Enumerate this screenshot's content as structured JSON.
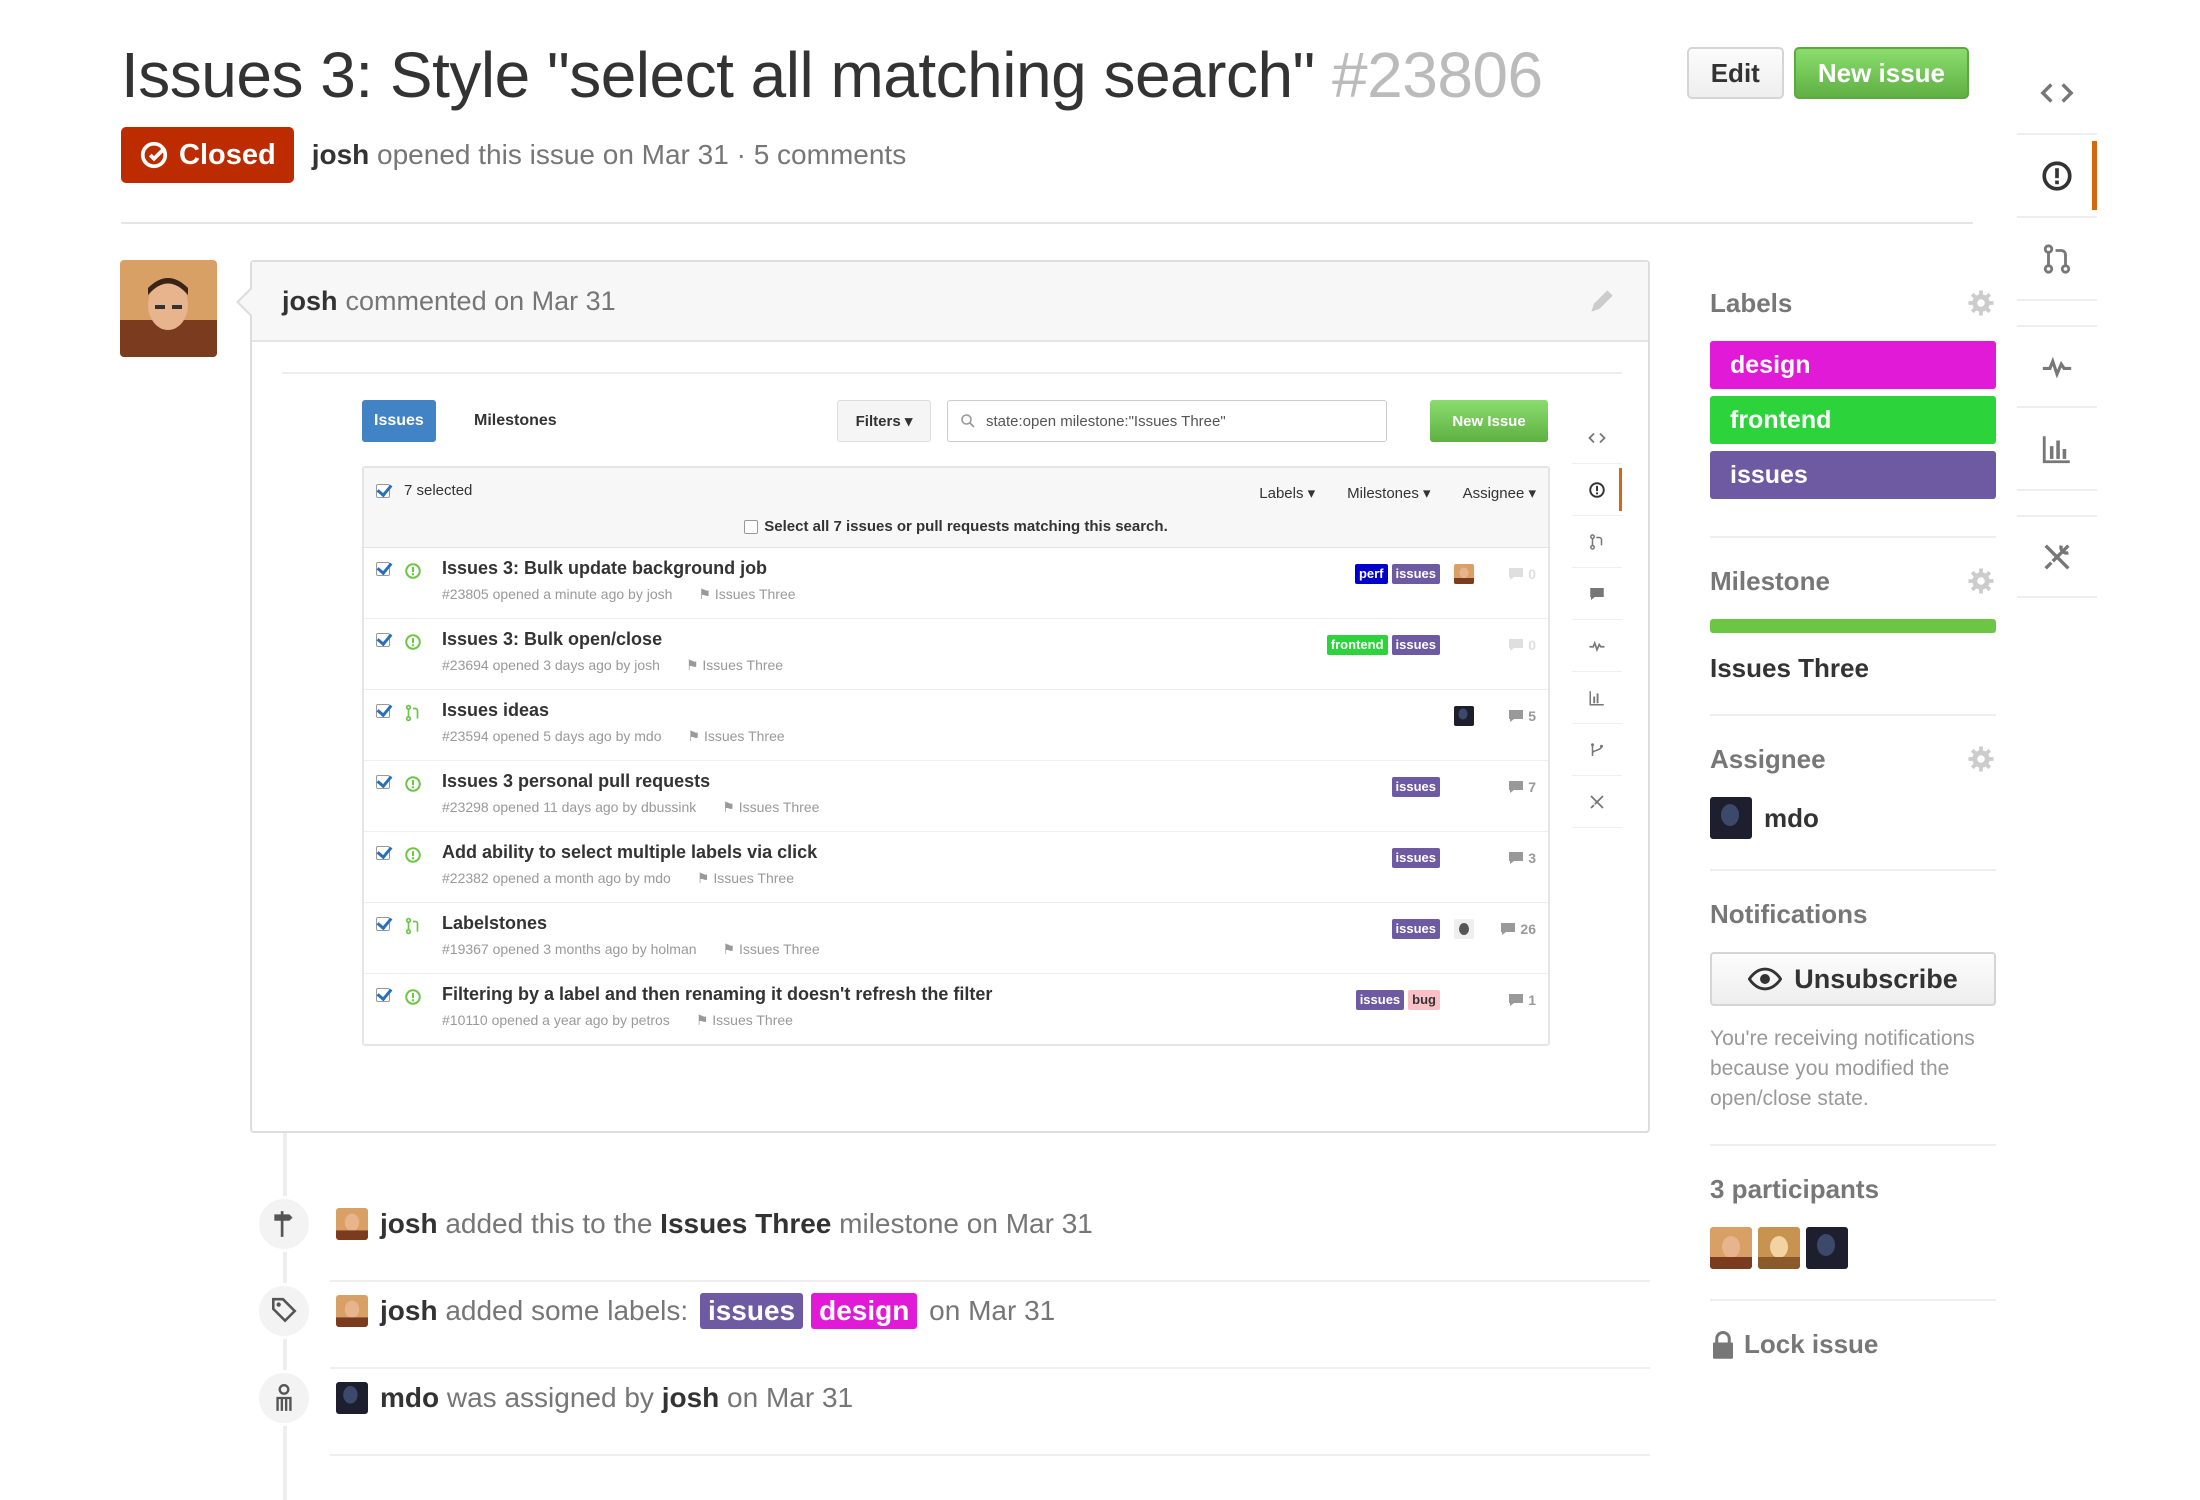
{
  "issue": {
    "title": "Issues 3: Style \"select all matching search\"",
    "number": "#23806",
    "state": "Closed",
    "author": "josh",
    "opened_text": "opened this issue on Mar 31 · 5 comments"
  },
  "header": {
    "edit_label": "Edit",
    "new_issue_label": "New issue"
  },
  "comment": {
    "author": "josh",
    "meta": "commented on Mar 31"
  },
  "screenshot": {
    "tabs": [
      "Issues",
      "Milestones"
    ],
    "filters_label": "Filters",
    "search_value": "state:open milestone:\"Issues Three\"",
    "new_issue_label": "New Issue",
    "selected_text": "7 selected",
    "dropdowns": [
      "Labels",
      "Milestones",
      "Assignee"
    ],
    "select_all_text": "Select all 7 issues or pull requests matching this search.",
    "rows": [
      {
        "kind": "issue",
        "title": "Issues 3: Bulk update background job",
        "sub": "#23805 opened a minute ago by josh",
        "milestone": "Issues Three",
        "labels": [
          {
            "name": "perf",
            "color": "#0000cc"
          },
          {
            "name": "issues",
            "color": "#6e59a3"
          }
        ],
        "avatar": "josh",
        "comments": "0"
      },
      {
        "kind": "issue",
        "title": "Issues 3: Bulk open/close",
        "sub": "#23694 opened 3 days ago by josh",
        "milestone": "Issues Three",
        "labels": [
          {
            "name": "frontend",
            "color": "#2cd33b"
          },
          {
            "name": "issues",
            "color": "#6e59a3"
          }
        ],
        "avatar": "",
        "comments": "0"
      },
      {
        "kind": "pr",
        "title": "Issues ideas",
        "sub": "#23594 opened 5 days ago by mdo",
        "milestone": "Issues Three",
        "labels": [],
        "avatar": "mdo",
        "comments": "5"
      },
      {
        "kind": "issue",
        "title": "Issues 3 personal pull requests",
        "sub": "#23298 opened 11 days ago by dbussink",
        "milestone": "Issues Three",
        "labels": [
          {
            "name": "issues",
            "color": "#6e59a3"
          }
        ],
        "avatar": "",
        "comments": "7"
      },
      {
        "kind": "issue",
        "title": "Add ability to select multiple labels via click",
        "sub": "#22382 opened a month ago by mdo",
        "milestone": "Issues Three",
        "labels": [
          {
            "name": "issues",
            "color": "#6e59a3"
          }
        ],
        "avatar": "",
        "comments": "3"
      },
      {
        "kind": "pr",
        "title": "Labelstones",
        "sub": "#19367 opened 3 months ago by holman",
        "milestone": "Issues Three",
        "labels": [
          {
            "name": "issues",
            "color": "#6e59a3"
          }
        ],
        "avatar": "holman",
        "comments": "26"
      },
      {
        "kind": "issue",
        "title": "Filtering by a label and then renaming it doesn't refresh the filter",
        "sub": "#10110 opened a year ago by petros",
        "milestone": "Issues Three",
        "labels": [
          {
            "name": "issues",
            "color": "#6e59a3"
          },
          {
            "name": "bug",
            "color": "#f9c0c8",
            "text_color": "#333"
          }
        ],
        "avatar": "",
        "comments": "1"
      }
    ]
  },
  "timeline": [
    {
      "icon": "milestone-icon",
      "avatar": "josh",
      "parts": [
        {
          "b": "josh"
        },
        {
          "t": " added this to the "
        },
        {
          "b": "Issues Three"
        },
        {
          "t": " milestone on Mar 31"
        }
      ]
    },
    {
      "icon": "tag-icon",
      "avatar": "josh",
      "parts": [
        {
          "b": "josh"
        },
        {
          "t": " added some labels: "
        },
        {
          "l": "issues",
          "c": "#6e59a3"
        },
        {
          "l": "design",
          "c": "#e11ad7"
        },
        {
          "t": " on Mar 31"
        }
      ]
    },
    {
      "icon": "person-icon",
      "avatar": "mdo",
      "parts": [
        {
          "b": "mdo"
        },
        {
          "t": " was assigned by "
        },
        {
          "b": "josh"
        },
        {
          "t": " on Mar 31"
        }
      ]
    }
  ],
  "sidebar": {
    "labels_title": "Labels",
    "labels": [
      {
        "name": "design",
        "color": "#e11ad7"
      },
      {
        "name": "frontend",
        "color": "#2cd33b"
      },
      {
        "name": "issues",
        "color": "#6e59a3"
      }
    ],
    "milestone_title": "Milestone",
    "milestone_name": "Issues Three",
    "milestone_progress": 1.0,
    "assignee_title": "Assignee",
    "assignee_name": "mdo",
    "notifications_title": "Notifications",
    "unsubscribe_label": "Unsubscribe",
    "notifications_note": "You're receiving notifications because you modified the open/close state.",
    "participants_title": "3 participants",
    "lock_label": "Lock issue"
  },
  "colors": {
    "closed": "#bd2c00",
    "green": "#6cc644",
    "accent_nav": "#d26911",
    "link_blue": "#4183c4"
  }
}
